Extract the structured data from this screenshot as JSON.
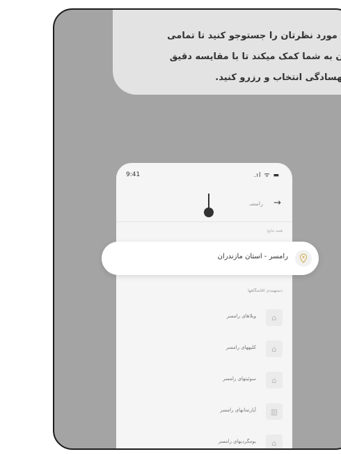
{
  "intro": {
    "line1": "دنی مورد نظرتان را جستوجو کنید تا تمامی",
    "line2": "مکان به شما کمک میکند تا با مقایسه دقیق",
    "line3": "را بهسادگی انتخاب و رزرو کنید."
  },
  "phone": {
    "time": "9:41",
    "status_icons": ".ıl ᯤ ▬",
    "back_arrow": "→",
    "search_text": "رامسـ",
    "recent_label": "همه نتایج",
    "suggestions_title": "دستهبندی اقامتگاهها",
    "items": [
      {
        "label": "ویلاهای رامسر",
        "icon": "villa-icon"
      },
      {
        "label": "کلبههای رامسر",
        "icon": "cabin-icon"
      },
      {
        "label": "سوئیتهای رامسر",
        "icon": "suite-icon"
      },
      {
        "label": "آپارتمانهای رامسر",
        "icon": "apartment-icon"
      },
      {
        "label": "بومگردیهای رامسر",
        "icon": "ecolodge-icon"
      }
    ]
  },
  "highlight": {
    "text": "رامسر - استان مازندران",
    "icon": "location-pin-icon"
  }
}
